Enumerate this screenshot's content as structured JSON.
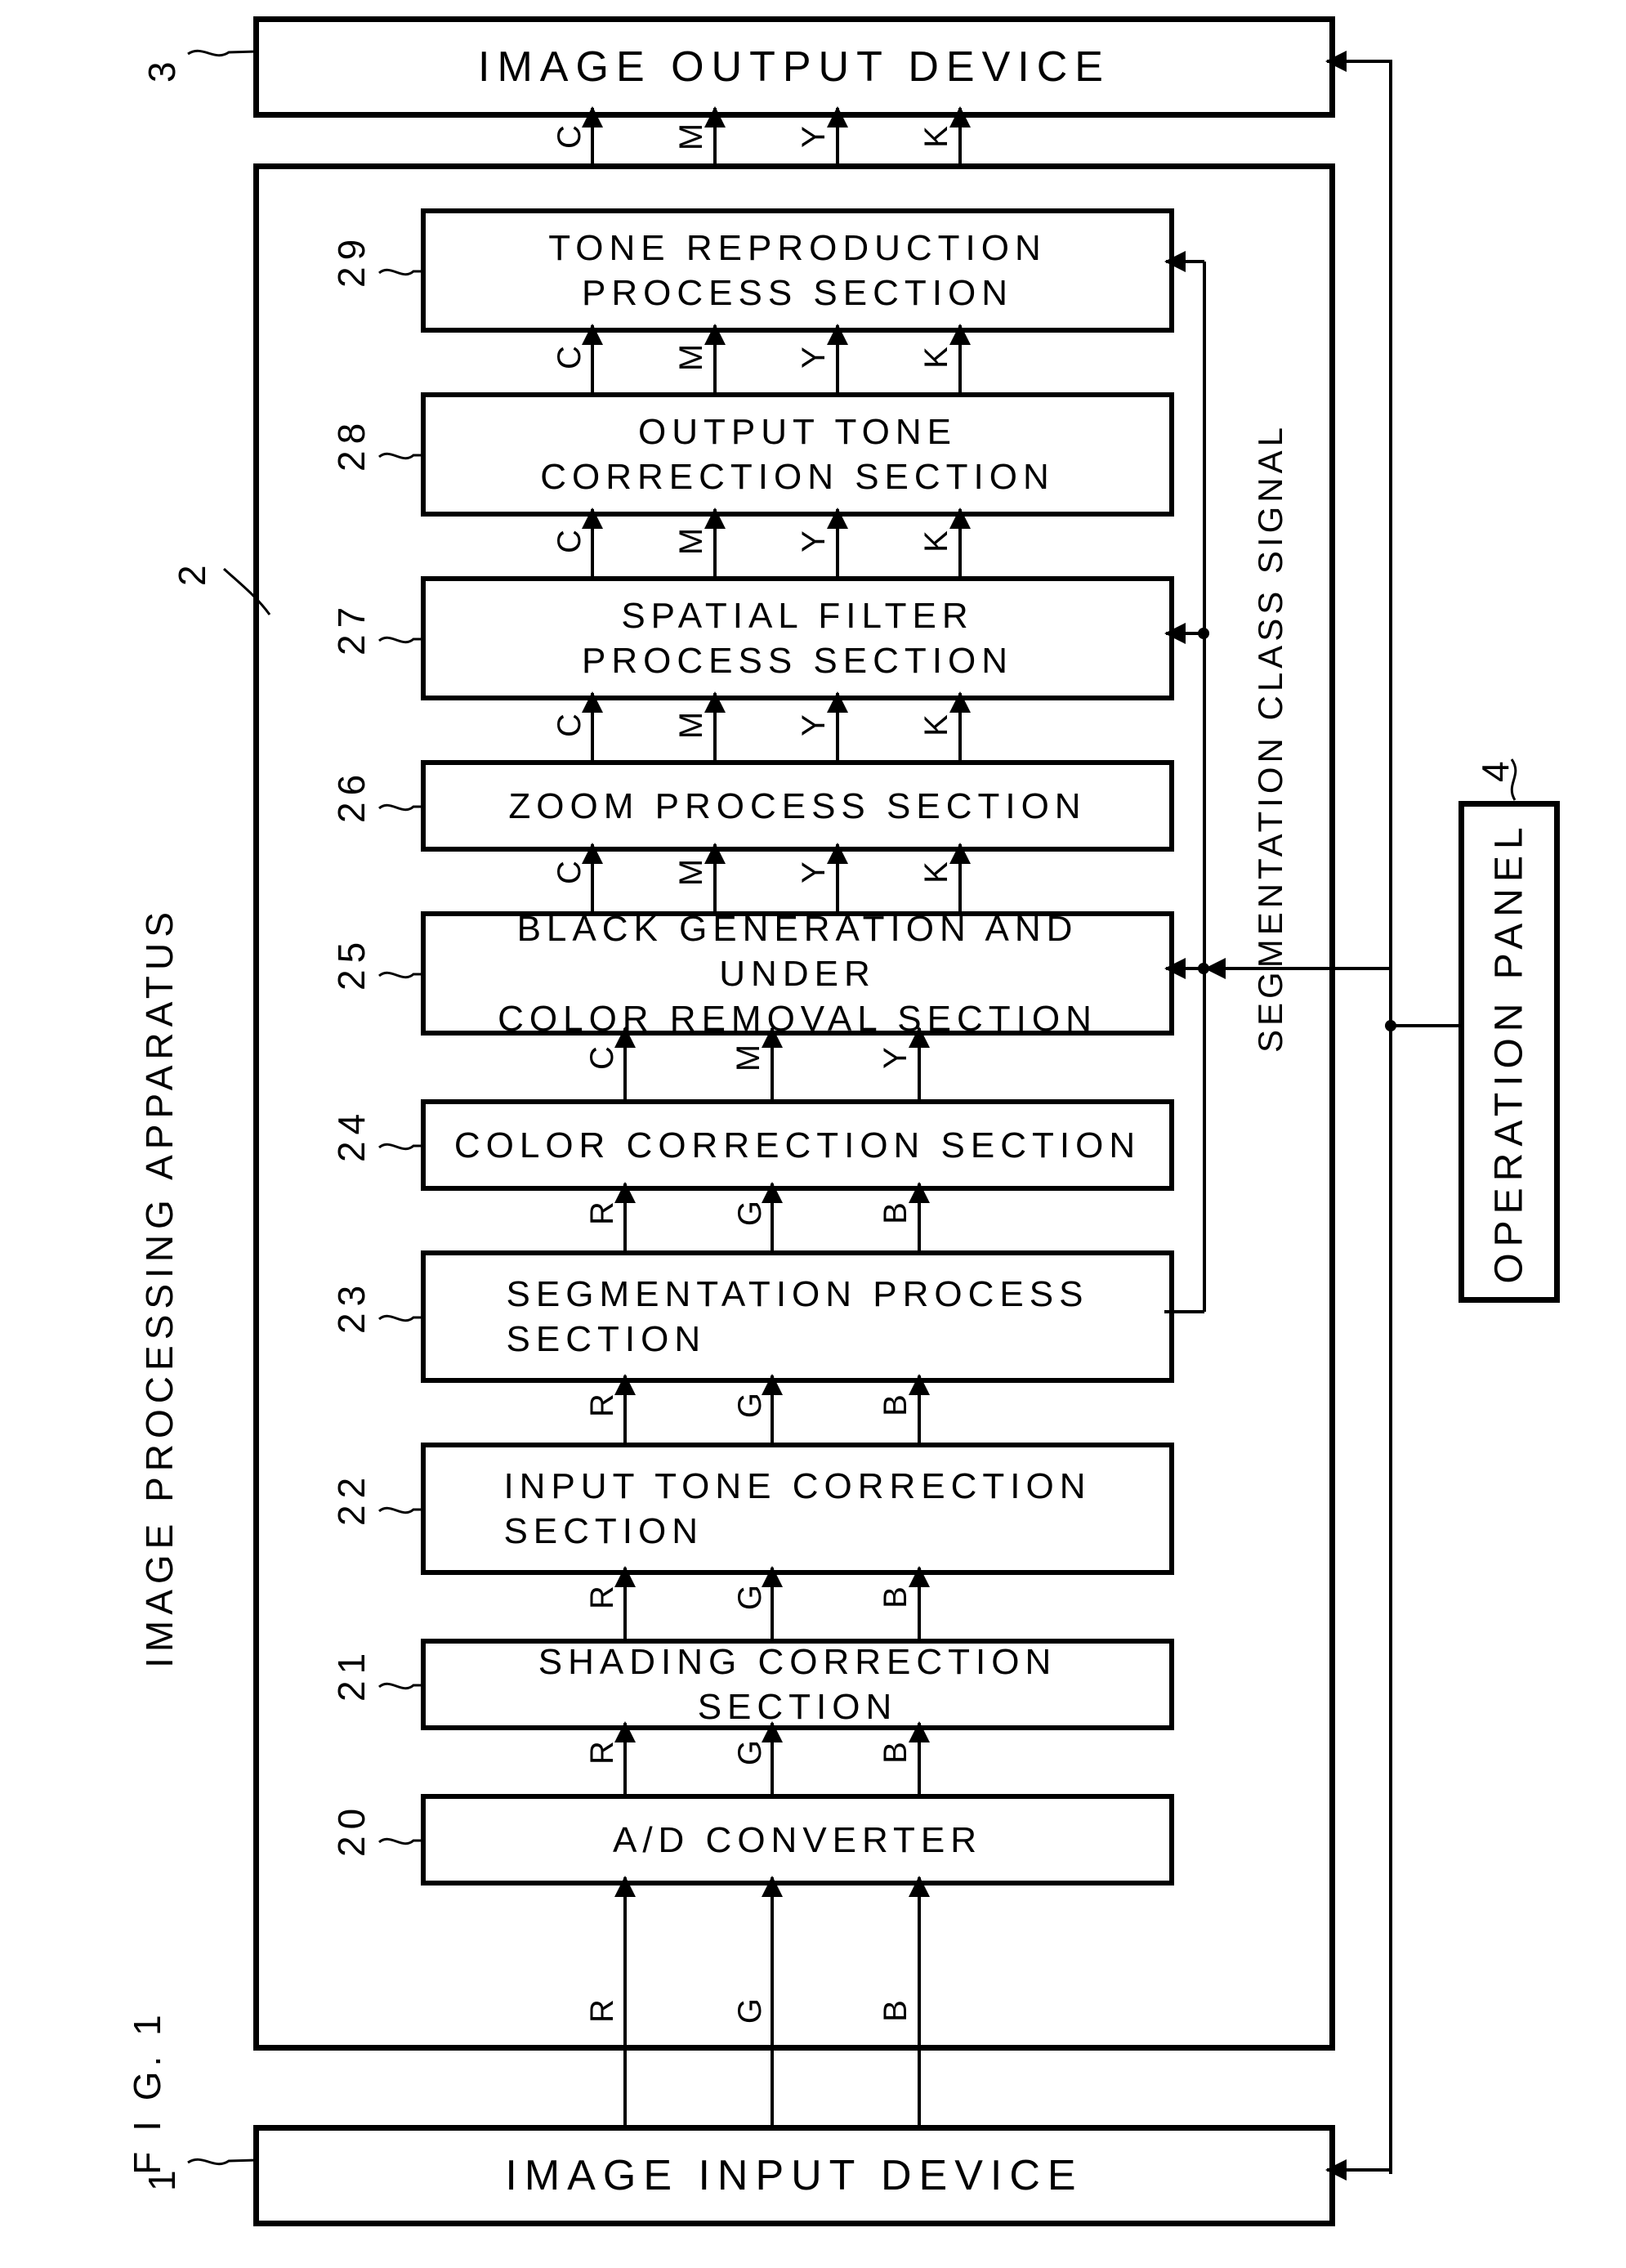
{
  "figure": {
    "caption": "F I G.  1"
  },
  "devices": {
    "image_output": {
      "label": "IMAGE OUTPUT DEVICE",
      "ref": "3"
    },
    "image_input": {
      "label": "IMAGE INPUT DEVICE",
      "ref": "1"
    },
    "operation_panel": {
      "label": "OPERATION PANEL",
      "ref": "4"
    }
  },
  "apparatus": {
    "label": "IMAGE PROCESSING APPARATUS",
    "ref": "2"
  },
  "signals": {
    "segmentation_class": "SEGMENTATION CLASS SIGNAL",
    "rgb": [
      "R",
      "G",
      "B"
    ],
    "cmy": [
      "C",
      "M",
      "Y"
    ],
    "cmyk": [
      "C",
      "M",
      "Y",
      "K"
    ]
  },
  "blocks": [
    {
      "ref": "29",
      "lines": [
        "TONE REPRODUCTION",
        "PROCESS SECTION"
      ]
    },
    {
      "ref": "28",
      "lines": [
        "OUTPUT TONE",
        "CORRECTION SECTION"
      ]
    },
    {
      "ref": "27",
      "lines": [
        "SPATIAL FILTER",
        "PROCESS SECTION"
      ]
    },
    {
      "ref": "26",
      "lines": [
        "ZOOM PROCESS SECTION"
      ]
    },
    {
      "ref": "25",
      "lines": [
        "BLACK GENERATION AND UNDER",
        "COLOR REMOVAL SECTION"
      ]
    },
    {
      "ref": "24",
      "lines": [
        "COLOR CORRECTION SECTION"
      ]
    },
    {
      "ref": "23",
      "lines": [
        "SEGMENTATION PROCESS",
        "SECTION"
      ]
    },
    {
      "ref": "22",
      "lines": [
        "INPUT TONE CORRECTION",
        "SECTION"
      ]
    },
    {
      "ref": "21",
      "lines": [
        "SHADING CORRECTION SECTION"
      ]
    },
    {
      "ref": "20",
      "lines": [
        "A/D CONVERTER"
      ]
    }
  ],
  "colors": {
    "ink": "#000000",
    "paper": "#ffffff"
  }
}
